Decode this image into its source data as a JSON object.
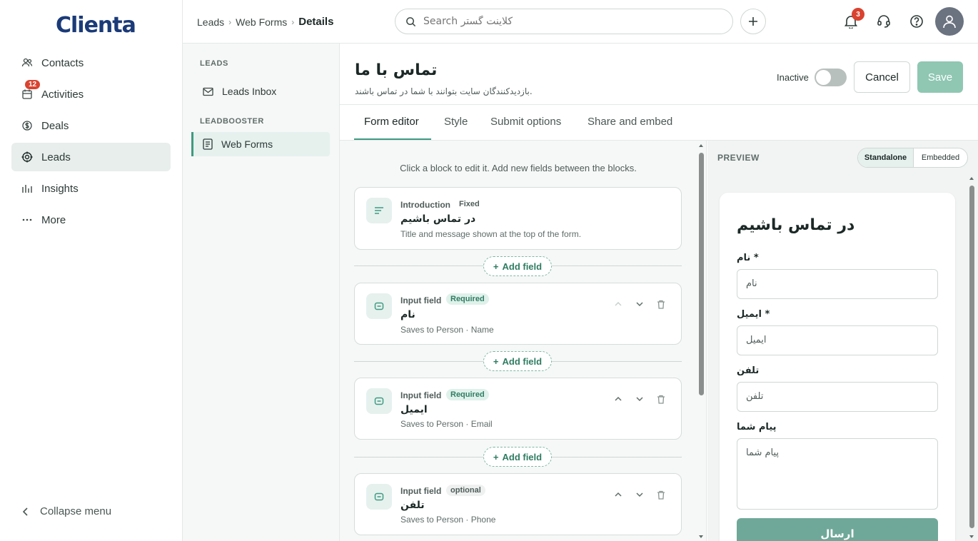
{
  "app": {
    "logo": "Clienta"
  },
  "nav": {
    "items": [
      {
        "label": "Contacts",
        "icon": "contacts-icon"
      },
      {
        "label": "Activities",
        "icon": "calendar-icon",
        "badge": "12"
      },
      {
        "label": "Deals",
        "icon": "deals-icon"
      },
      {
        "label": "Leads",
        "icon": "target-icon",
        "active": true
      },
      {
        "label": "Insights",
        "icon": "bar-chart-icon"
      },
      {
        "label": "More",
        "icon": "more-icon"
      }
    ],
    "collapse_label": "Collapse menu"
  },
  "header": {
    "breadcrumb": [
      "Leads",
      "Web Forms",
      "Details"
    ],
    "search_placeholder": "Search کلاینت گستر",
    "notification_count": "3"
  },
  "subnav": {
    "section1": "LEADS",
    "item1": "Leads Inbox",
    "section2": "LEADBOOSTER",
    "item2": "Web Forms"
  },
  "form": {
    "title": "تماس با ما",
    "subtitle": "بازدیدکنندگان سایت بتوانند با شما در تماس باشند.",
    "status_label": "Inactive",
    "cancel_label": "Cancel",
    "save_label": "Save"
  },
  "tabs": [
    "Form editor",
    "Style",
    "Submit options",
    "Share and embed"
  ],
  "editor": {
    "hint": "Click a block to edit it. Add new fields between the blocks.",
    "add_field_label": "Add field",
    "blocks": [
      {
        "type": "Introduction",
        "tag": "Fixed",
        "name": "در تماس باشیم",
        "desc": "Title and message shown at the top of the form."
      },
      {
        "type": "Input field",
        "tag": "Required",
        "name": "نام",
        "desc": "Saves to Person · Name"
      },
      {
        "type": "Input field",
        "tag": "Required",
        "name": "ایمیل",
        "desc": "Saves to Person · Email"
      },
      {
        "type": "Input field",
        "tag": "optional",
        "name": "تلفن",
        "desc": "Saves to Person · Phone"
      }
    ]
  },
  "preview": {
    "label": "PREVIEW",
    "mode_standalone": "Standalone",
    "mode_embedded": "Embedded",
    "title": "در تماس باشیم",
    "fields": [
      {
        "label": "نام *",
        "placeholder": "نام"
      },
      {
        "label": "ایمیل *",
        "placeholder": "ایمیل"
      },
      {
        "label": "تلفن",
        "placeholder": "تلفن"
      },
      {
        "label": "پیام شما",
        "placeholder": "پیام شما"
      }
    ],
    "submit_label": "ارسال"
  },
  "colors": {
    "accent": "#3f9a80",
    "brand": "#1a3a78",
    "badge": "#d9432f",
    "save_disabled": "#8fc7b3"
  }
}
